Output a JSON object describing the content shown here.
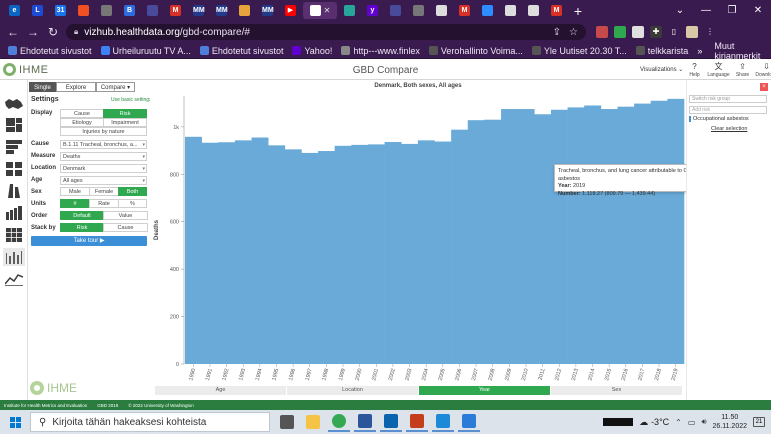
{
  "browser": {
    "tabs": [
      {
        "icon": "ie-icon",
        "color": "#0a66c2",
        "glyph": "e"
      },
      {
        "icon": "l-icon",
        "color": "#1e4bd6",
        "glyph": "L"
      },
      {
        "icon": "calendar-icon",
        "color": "#1a73e8",
        "glyph": "31"
      },
      {
        "icon": "ms-icon",
        "color": "#f25022",
        "glyph": ""
      },
      {
        "icon": "person-icon",
        "color": "#777777",
        "glyph": ""
      },
      {
        "icon": "b-icon",
        "color": "#2d6cdf",
        "glyph": "B"
      },
      {
        "icon": "vpn-icon",
        "color": "#4a4a9a",
        "glyph": ""
      },
      {
        "icon": "gmail-icon",
        "color": "#d93025",
        "glyph": "M"
      },
      {
        "icon": "mm-icon",
        "color": "#233a8b",
        "glyph": "MM"
      },
      {
        "icon": "mm2-icon",
        "color": "#233a8b",
        "glyph": "MM"
      },
      {
        "icon": "doc-icon",
        "color": "#e8a33d",
        "glyph": ""
      },
      {
        "icon": "mm3-icon",
        "color": "#233a8b",
        "glyph": "MM"
      },
      {
        "icon": "youtube-icon",
        "color": "#ff0000",
        "glyph": "▶"
      },
      {
        "icon": "active-tab",
        "color": "#ffffff",
        "glyph": ""
      },
      {
        "icon": "arrow-icon",
        "color": "#26a69a",
        "glyph": ""
      },
      {
        "icon": "yahoo-icon",
        "color": "#6001d2",
        "glyph": "y"
      },
      {
        "icon": "vpn2-icon",
        "color": "#4a4a9a",
        "glyph": ""
      },
      {
        "icon": "person2-icon",
        "color": "#777777",
        "glyph": ""
      },
      {
        "icon": "page-icon",
        "color": "#dddddd",
        "glyph": ""
      },
      {
        "icon": "gmail2-icon",
        "color": "#d93025",
        "glyph": "M"
      },
      {
        "icon": "zoom-icon",
        "color": "#2d8cff",
        "glyph": ""
      },
      {
        "icon": "page2-icon",
        "color": "#dddddd",
        "glyph": ""
      },
      {
        "icon": "page3-icon",
        "color": "#dddddd",
        "glyph": ""
      },
      {
        "icon": "gmail3-icon",
        "color": "#d93025",
        "glyph": "M"
      }
    ],
    "active_tab_close": "✕",
    "new_tab": "+",
    "window_controls": {
      "tab_search": "⌄",
      "minimize": "—",
      "maximize": "❐",
      "close": "✕"
    },
    "url_host": "vizhub.healthdata.org",
    "url_path": "/gbd-compare/#",
    "bookmarks": [
      {
        "label": "Ehdotetut sivustot",
        "color": "#4f7fd9"
      },
      {
        "label": "Urheiluruutu TV A...",
        "color": "#3e82f7"
      },
      {
        "label": "Ehdotetut sivustot",
        "color": "#4f7fd9"
      },
      {
        "label": "Yahoo!",
        "color": "#6001d2"
      },
      {
        "label": "http---www.finlex",
        "color": "#888888"
      },
      {
        "label": "Verohallinto Voima...",
        "color": "#555555"
      },
      {
        "label": "Yle Uutiset 20.30  T...",
        "color": "#555555"
      },
      {
        "label": "telkkarista",
        "color": "#555555"
      }
    ],
    "bookmarks_overflow": "»",
    "other_bookmarks": "Muut kirjanmerkit"
  },
  "app": {
    "logo_text": "IHME",
    "title": "GBD Compare",
    "visualizations_label": "Visualizations ⌄",
    "tools": [
      {
        "icon": "help-icon",
        "glyph": "?",
        "label": "Help"
      },
      {
        "icon": "language-icon",
        "glyph": "文",
        "label": "Language"
      },
      {
        "icon": "share-icon",
        "glyph": "⇪",
        "label": "Share"
      },
      {
        "icon": "download-icon",
        "glyph": "⇩",
        "label": "Download"
      }
    ]
  },
  "settings": {
    "mode_tabs": [
      {
        "label": "Single",
        "selected": true
      },
      {
        "label": "Explore",
        "selected": false
      },
      {
        "label": "Compare ▾",
        "selected": false
      }
    ],
    "title": "Settings",
    "basic_link": "Use basic settings",
    "display_label": "Display",
    "display_options": [
      {
        "label": "Cause",
        "selected": false
      },
      {
        "label": "Risk",
        "selected": true
      },
      {
        "label": "Etiology",
        "selected": false
      },
      {
        "label": "Impairment",
        "selected": false
      },
      {
        "label": "Injuries by nature",
        "selected": false
      }
    ],
    "cause_label": "Cause",
    "cause_value": "B.1.11 Tracheal, bronchus, a...",
    "measure_label": "Measure",
    "measure_value": "Deaths",
    "location_label": "Location",
    "location_value": "Denmark",
    "age_label": "Age",
    "age_value": "All ages",
    "sex_label": "Sex",
    "sex_options": [
      {
        "label": "Male",
        "selected": false
      },
      {
        "label": "Female",
        "selected": false
      },
      {
        "label": "Both",
        "selected": true
      }
    ],
    "units_label": "Units",
    "units_options": [
      {
        "label": "#",
        "selected": true
      },
      {
        "label": "Rate",
        "selected": false
      },
      {
        "label": "%",
        "selected": false
      }
    ],
    "order_label": "Order",
    "order_options": [
      {
        "label": "Default",
        "selected": true
      },
      {
        "label": "Value",
        "selected": false
      }
    ],
    "stack_label": "Stack by",
    "stack_options": [
      {
        "label": "Risk",
        "selected": true
      },
      {
        "label": "Cause",
        "selected": false
      }
    ],
    "tour_button": "Take tour ▶",
    "bottom_logo": "IHME"
  },
  "chart_data": {
    "type": "area",
    "title": "Denmark, Both sexes, All ages",
    "ylabel": "Deaths",
    "xlabel": "",
    "ylim": [
      0,
      1130
    ],
    "yticks": [
      0,
      200,
      400,
      600,
      800,
      1000
    ],
    "ytick_labels": [
      "0",
      "200",
      "400",
      "600",
      "800",
      "1k"
    ],
    "x": [
      1990,
      1991,
      1992,
      1993,
      1994,
      1995,
      1996,
      1997,
      1998,
      1999,
      2000,
      2001,
      2002,
      2003,
      2004,
      2005,
      2006,
      2007,
      2008,
      2009,
      2010,
      2011,
      2012,
      2013,
      2014,
      2015,
      2016,
      2017,
      2018,
      2019
    ],
    "series": [
      {
        "color": "#6aaad8",
        "values": [
          958,
          933,
          935,
          943,
          955,
          922,
          905,
          890,
          898,
          920,
          924,
          926,
          936,
          928,
          943,
          938,
          988,
          1028,
          1030,
          1075,
          1075,
          1053,
          1072,
          1082,
          1090,
          1075,
          1085,
          1098,
          1110,
          1118
        ]
      }
    ]
  },
  "bottom_tabs": [
    {
      "label": "Age",
      "selected": false
    },
    {
      "label": "Location",
      "selected": false
    },
    {
      "label": "Year",
      "selected": true
    },
    {
      "label": "Sex",
      "selected": false
    }
  ],
  "tooltip": {
    "title": "Tracheal, bronchus, and lung cancer attributable to Occupational exposure to asbestos",
    "year_label": "Year:",
    "year_value": "2019",
    "number_label": "Number:",
    "number_value": "1,118.27 (809.79 — 1,439.44)"
  },
  "right_panel": {
    "select_placeholder": "Switch risk group",
    "search_placeholder": "Add risk",
    "selected_item": "Occupational asbestos",
    "clear": "Clear selection",
    "close": "×"
  },
  "footer": {
    "institute": "Institute for Health Metrics and Evaluation",
    "edition": "GBD 2019",
    "copyright": "© 2022 University of Washington"
  },
  "taskbar": {
    "search_placeholder": "Kirjoita tähän hakeaksesi kohteista",
    "apps": [
      {
        "icon": "task-view-icon",
        "color": "#555555"
      },
      {
        "icon": "file-explorer-icon",
        "color": "#f6c445"
      },
      {
        "icon": "chrome-icon",
        "color": "#34a853"
      },
      {
        "icon": "word-icon",
        "color": "#2b579a"
      },
      {
        "icon": "outlook-icon",
        "color": "#0a64ad"
      },
      {
        "icon": "powerpoint-icon",
        "color": "#c43e1c"
      },
      {
        "icon": "edge-icon",
        "color": "#1c8ad6"
      },
      {
        "icon": "store-icon",
        "color": "#2b7bd8"
      }
    ],
    "temperature": "-3°C",
    "time": "11.50",
    "date": "26.11.2022",
    "notification": "21"
  }
}
